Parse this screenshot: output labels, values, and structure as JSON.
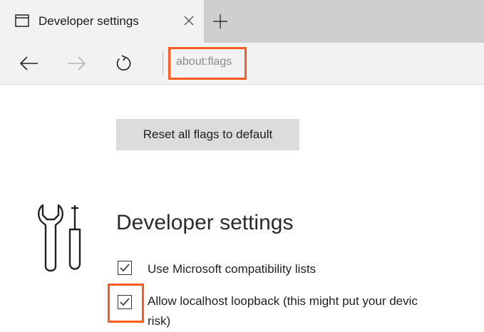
{
  "tab": {
    "title": "Developer settings",
    "icon": "page-icon",
    "close_icon": "close-icon",
    "new_tab_icon": "plus-icon"
  },
  "nav": {
    "back_icon": "arrow-left-icon",
    "forward_icon": "arrow-right-icon",
    "refresh_icon": "refresh-icon",
    "address": "about:flags",
    "highlight_color": "#ff5a1f"
  },
  "content": {
    "reset_button_label": "Reset all flags to default",
    "section_icon": "tools-icon",
    "section_title": "Developer settings",
    "options": [
      {
        "label": "Use Microsoft compatibility lists",
        "checked": true
      },
      {
        "label_line1": "Allow localhost loopback (this might put your devic",
        "label_line2": "risk)",
        "checked": true
      }
    ]
  },
  "colors": {
    "tabstrip": "#cfcfcf",
    "active_tab": "#f2f2f2",
    "button_bg": "#dcdcdc",
    "highlight": "#ff5a1f"
  }
}
